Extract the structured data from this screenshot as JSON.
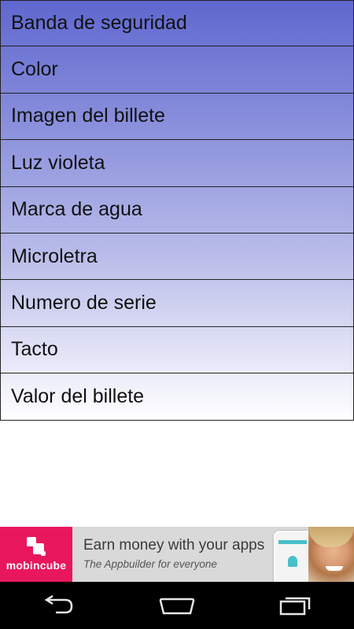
{
  "menu": {
    "items": [
      {
        "label": "Banda de seguridad"
      },
      {
        "label": "Color"
      },
      {
        "label": "Imagen del billete"
      },
      {
        "label": "Luz violeta"
      },
      {
        "label": "Marca de agua"
      },
      {
        "label": "Microletra"
      },
      {
        "label": "Numero de serie"
      },
      {
        "label": "Tacto"
      },
      {
        "label": "Valor del billete"
      }
    ]
  },
  "ad": {
    "brand": "mobincube",
    "title": "Earn money with your apps",
    "subtitle": "The Appbuilder for everyone",
    "brand_color": "#e8175d"
  },
  "nav": {
    "back_icon": "back-icon",
    "home_icon": "home-icon",
    "recents_icon": "recents-icon"
  }
}
